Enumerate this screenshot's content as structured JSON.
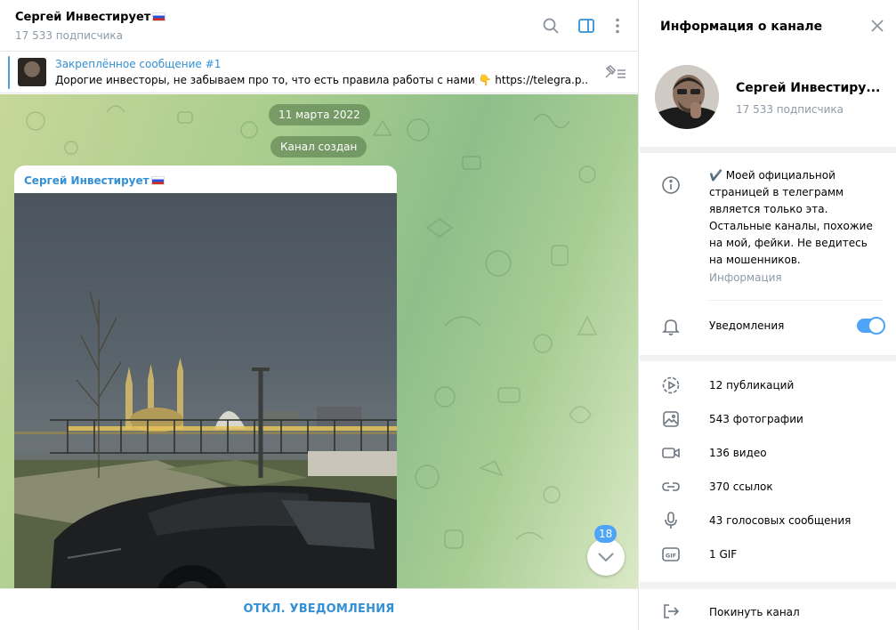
{
  "header": {
    "title": "Сергей Инвестирует",
    "subscribers": "17 533 подписчика",
    "flag_icon": "russia-flag-icon"
  },
  "pinned": {
    "title": "Закреплённое сообщение #1",
    "text": "Дорогие инвесторы, не забываем про то, что есть правила работы с нами 👇 https://telegra.p..."
  },
  "chat": {
    "date_pill": "11 марта 2022",
    "service_pill": "Канал создан",
    "message_author": "Сергей Инвестирует",
    "unread_count": "18"
  },
  "bottom_action": "ОТКЛ. УВЕДОМЛЕНИЯ",
  "sidebar": {
    "title": "Информация о канале",
    "name": "Сергей Инвестиру...",
    "subscribers": "17 533 подписчика",
    "description": "✔️ Моей официальной\nстраницей в телеграмм\nявляется только эта.\nОстальные каналы, похожие\nна мой, фейки. Не ведитесь\nна мошенников.",
    "description_label": "Информация",
    "notifications_label": "Уведомления",
    "notifications_on": true,
    "media": [
      {
        "icon": "video-message-icon",
        "label": "12 публикаций"
      },
      {
        "icon": "photo-icon",
        "label": "543 фотографии"
      },
      {
        "icon": "video-icon",
        "label": "136 видео"
      },
      {
        "icon": "link-icon",
        "label": "370 ссылок"
      },
      {
        "icon": "microphone-icon",
        "label": "43 голосовых сообщения"
      },
      {
        "icon": "gif-icon",
        "label": "1 GIF"
      }
    ],
    "leave_label": "Покинуть канал"
  },
  "colors": {
    "accent": "#3390d6",
    "toggle": "#4ea4f6",
    "muted_text": "#8e9aa5"
  }
}
